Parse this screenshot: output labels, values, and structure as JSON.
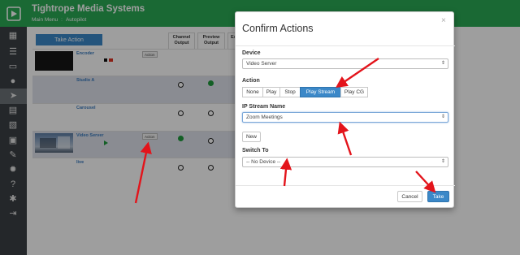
{
  "app": {
    "title": "Tightrope Media Systems",
    "breadcrumb": [
      "Main Menu",
      "Autopilot"
    ],
    "breadcrumb_separator": ":"
  },
  "sidebar": {
    "logo": "play-logo-icon",
    "items": [
      {
        "icon": "calendar-icon",
        "glyph": "▦"
      },
      {
        "icon": "list-icon",
        "glyph": "☰"
      },
      {
        "icon": "monitor-icon",
        "glyph": "▭"
      },
      {
        "icon": "lightbulb-icon",
        "glyph": "●"
      },
      {
        "icon": "send-icon",
        "glyph": "➤",
        "active": true
      },
      {
        "icon": "film-icon",
        "glyph": "▤"
      },
      {
        "icon": "image-icon",
        "glyph": "▧"
      },
      {
        "icon": "display-icon",
        "glyph": "▣"
      },
      {
        "icon": "wrench-icon",
        "glyph": "✎"
      },
      {
        "icon": "gear-icon",
        "glyph": "✹"
      },
      {
        "icon": "help-icon",
        "glyph": "?"
      },
      {
        "icon": "accessibility-icon",
        "glyph": "✱"
      },
      {
        "icon": "logout-icon",
        "glyph": "⇥"
      }
    ]
  },
  "main": {
    "take_action_label": "Take Action",
    "columns": [
      "Channel Output",
      "Preview Output",
      "Ex"
    ],
    "rows": [
      {
        "name": "Encoder",
        "action": "Action",
        "thumb": "black",
        "channel": null,
        "preview": null
      },
      {
        "name": "Studio A",
        "action": "",
        "thumb": "none",
        "channel": "off",
        "preview": "on"
      },
      {
        "name": "Carousel",
        "action": "",
        "thumb": "none",
        "channel": "off",
        "preview": "off"
      },
      {
        "name": "Video Server",
        "action": "Action",
        "thumb": "video",
        "channel": "on",
        "preview": "off"
      },
      {
        "name": "live",
        "action": "",
        "thumb": "none",
        "channel": "off",
        "preview": "off"
      }
    ]
  },
  "modal": {
    "title": "Confirm Actions",
    "close": "×",
    "device_label": "Device",
    "device_value": "Video Server",
    "action_label": "Action",
    "actions": [
      "None",
      "Play",
      "Stop",
      "Play Stream",
      "Play CG"
    ],
    "selected_action": "Play Stream",
    "stream_label": "IP Stream Name",
    "stream_value": "Zoom Meetings",
    "new_label": "New",
    "switch_label": "Switch To",
    "switch_value": "-- No Device --",
    "cancel_label": "Cancel",
    "take_label": "Take"
  },
  "colors": {
    "brand_green": "#2aaa55",
    "accent_blue": "#3b88c8",
    "sidebar": "#3b4044",
    "annotation_red": "#e3141b",
    "status_on": "#1f9a3c"
  }
}
